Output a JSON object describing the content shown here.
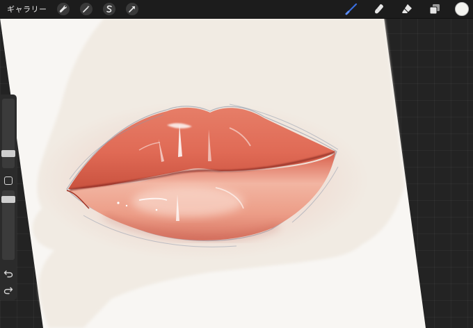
{
  "topbar": {
    "gallery_label": "ギャラリー",
    "left_tools": [
      "wrench-icon",
      "magic-wand-icon",
      "selection-icon",
      "transform-arrow-icon"
    ],
    "right_tools": [
      "brush-icon",
      "smudge-icon",
      "eraser-icon",
      "layers-icon"
    ],
    "active_color": "#f4f4f0",
    "brush_color": "#3a6fe0"
  },
  "sidebar": {
    "brush_size_level": 0.55,
    "opacity_level": 0.9,
    "buttons": [
      "modify-button",
      "undo-icon",
      "redo-icon"
    ]
  },
  "canvas": {
    "artwork": "lips-painting",
    "paper_color": "#f8f6f3",
    "background_wash_color": "#f1ebe3"
  }
}
